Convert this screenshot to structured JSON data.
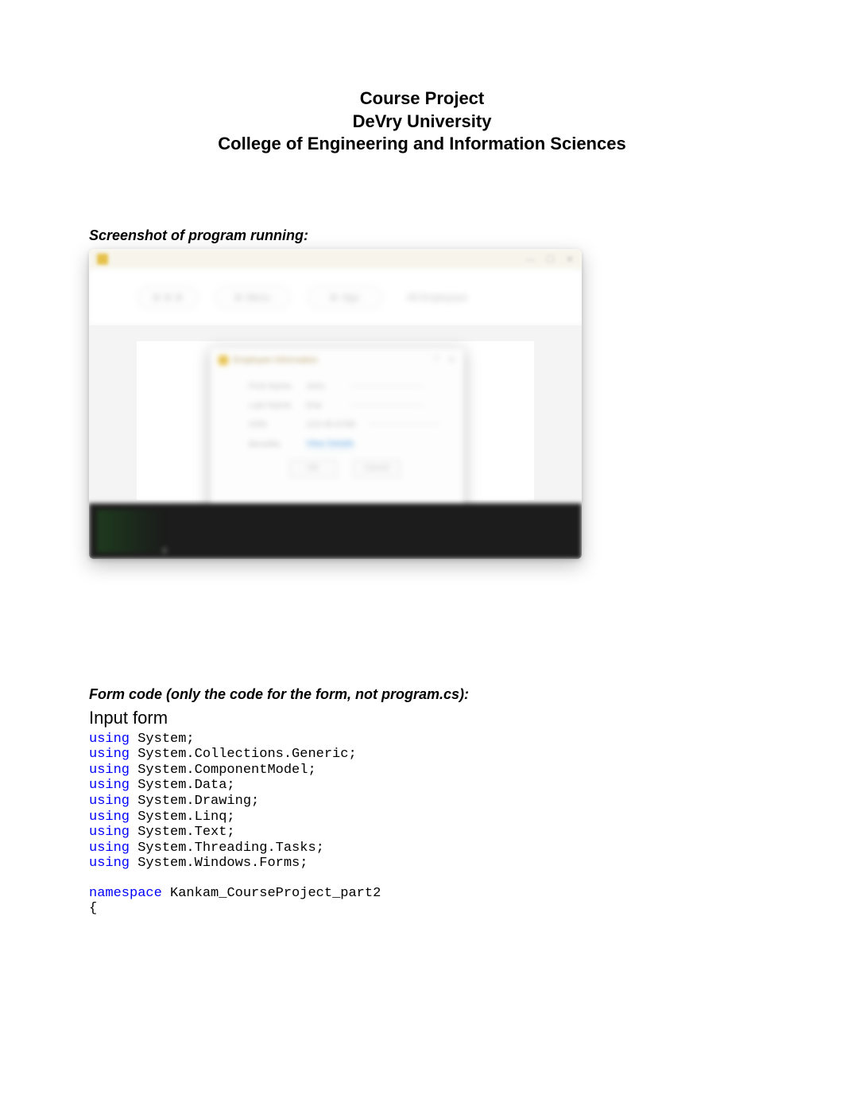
{
  "header": {
    "line1": "Course Project",
    "line2": "DeVry University",
    "line3": "College of Engineering and Information Sciences"
  },
  "screenshot_label": "Screenshot of program running:",
  "app_window": {
    "toolbar": {
      "btn1": "",
      "btn2": "Menu",
      "btn3": "App",
      "btn4": "All Employees"
    },
    "modal": {
      "title": "Employee Information",
      "rows": [
        {
          "label": "First Name",
          "value": "John"
        },
        {
          "label": "Last Name",
          "value": "Doe"
        },
        {
          "label": "SSN",
          "value": "123-45-6789"
        },
        {
          "label": "Benefits",
          "value": "View Details"
        }
      ],
      "button_ok": "OK",
      "button_cancel": "Cancel"
    },
    "bottom_char": "0"
  },
  "form_code_label": "Form code (only the code for the form, not program.cs):",
  "form_subheader": "Input form",
  "code": {
    "kw_using": "using",
    "kw_namespace": "namespace",
    "lines": [
      " System;",
      " System.Collections.Generic;",
      " System.ComponentModel;",
      " System.Data;",
      " System.Drawing;",
      " System.Linq;",
      " System.Text;",
      " System.Threading.Tasks;",
      " System.Windows.Forms;"
    ],
    "ns_line": " Kankam_CourseProject_part2",
    "brace": "{"
  }
}
